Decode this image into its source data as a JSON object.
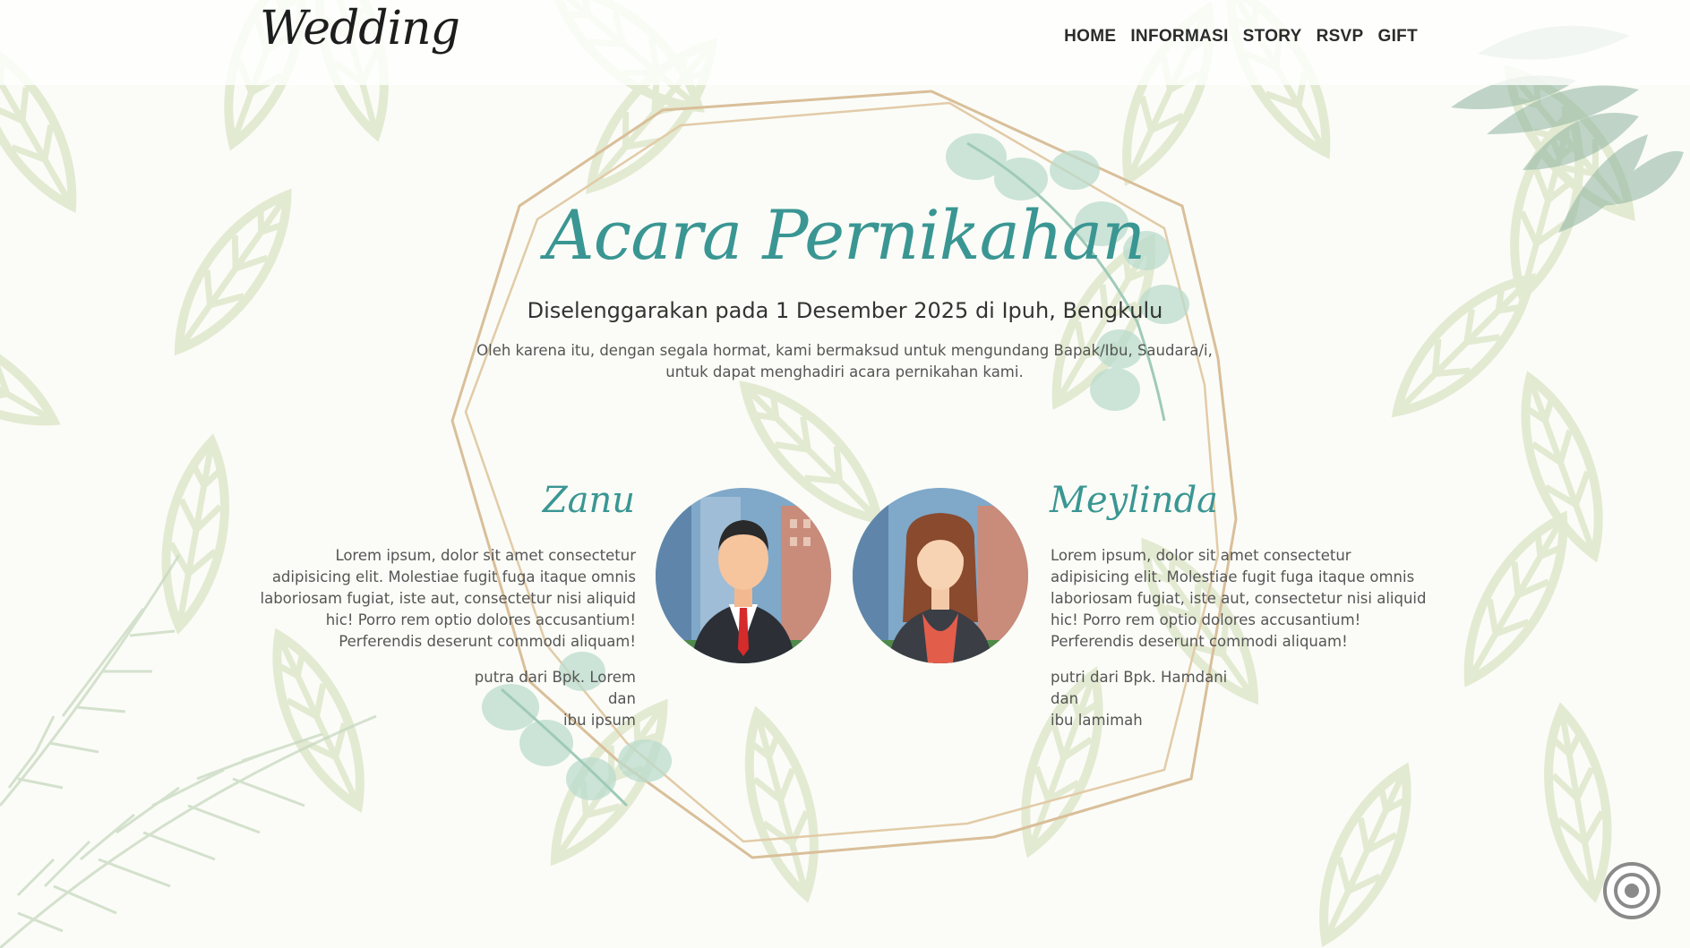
{
  "navbar": {
    "brand": "Wedding",
    "links": [
      {
        "label": "HOME"
      },
      {
        "label": "INFORMASI"
      },
      {
        "label": "STORY"
      },
      {
        "label": "RSVP"
      },
      {
        "label": "GIFT"
      }
    ]
  },
  "hero": {
    "title": "Acara Pernikahan",
    "subtitle": "Diselenggarakan pada 1 Desember 2025 di Ipuh, Bengkulu",
    "intro": "Oleh karena itu, dengan segala hormat, kami bermaksud untuk mengundang Bapak/Ibu, Saudara/i, untuk dapat menghadiri acara pernikahan kami."
  },
  "groom": {
    "name": "Zanu",
    "bio": "Lorem ipsum, dolor sit amet consectetur adipisicing elit. Molestiae fugit fuga itaque omnis laboriosam fugiat, iste aut, consectetur nisi aliquid hic! Porro rem optio dolores accusantium! Perferendis deserunt commodi aliquam!",
    "parents_line1": "putra dari Bpk. Lorem",
    "parents_line2": "dan",
    "parents_line3": "ibu ipsum"
  },
  "bride": {
    "name": "Meylinda",
    "bio": "Lorem ipsum, dolor sit amet consectetur adipisicing elit. Molestiae fugit fuga itaque omnis laboriosam fugiat, iste aut, consectetur nisi aliquid hic! Porro rem optio dolores accusantium! Perferendis deserunt commodi aliquam!",
    "parents_line1": "putri dari Bpk. Hamdani",
    "parents_line2": "dan",
    "parents_line3": "ibu lamimah"
  },
  "colors": {
    "accent": "#3a9693",
    "background": "#fbfcf7",
    "leaf": "#e3ead2",
    "frame_gold": "#d9bf9a",
    "eucalyptus": "#9fcab8"
  },
  "icons": {
    "audio": "audio-toggle-icon"
  }
}
